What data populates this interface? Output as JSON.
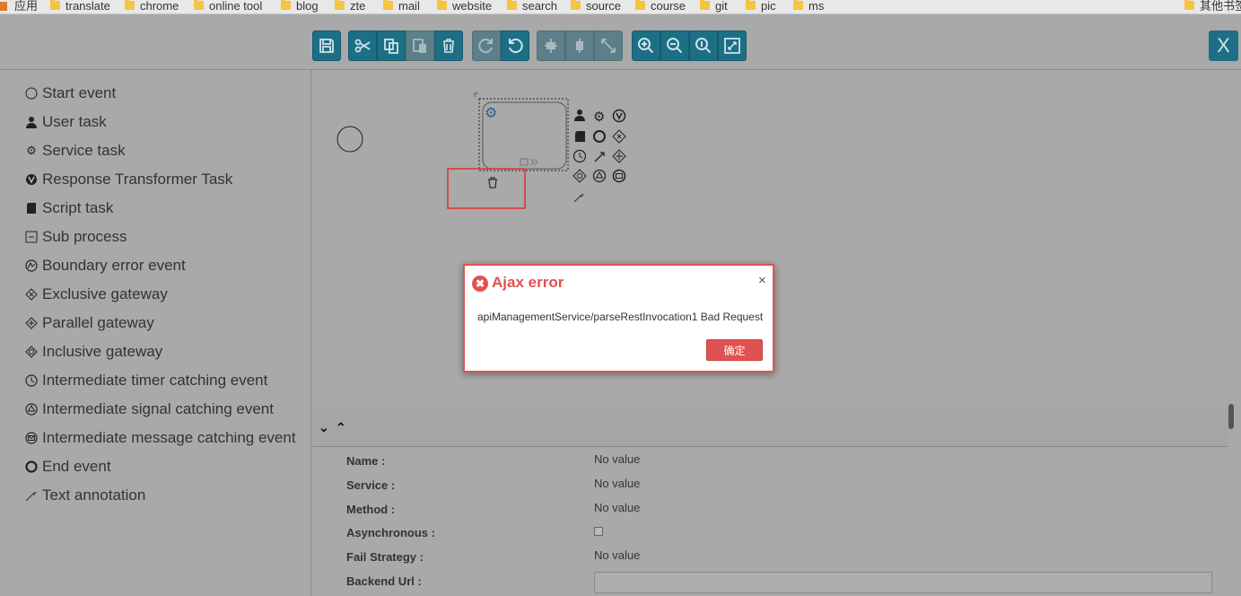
{
  "bookmarks": {
    "apps_label": "应用",
    "items": [
      "translate",
      "chrome",
      "online tool",
      "blog",
      "zte",
      "mail",
      "website",
      "search",
      "source",
      "course",
      "git",
      "pic",
      "ms"
    ],
    "other_label": "其他书签"
  },
  "toolbar": {
    "close_label": "X"
  },
  "palette": {
    "items": [
      {
        "label": "Start event",
        "icon": "start-event-icon"
      },
      {
        "label": "User task",
        "icon": "user-icon"
      },
      {
        "label": "Service task",
        "icon": "gear-icon"
      },
      {
        "label": "Response Transformer Task",
        "icon": "transformer-icon"
      },
      {
        "label": "Script task",
        "icon": "script-icon"
      },
      {
        "label": "Sub process",
        "icon": "subprocess-icon"
      },
      {
        "label": "Boundary error event",
        "icon": "error-event-icon"
      },
      {
        "label": "Exclusive gateway",
        "icon": "exclusive-gateway-icon"
      },
      {
        "label": "Parallel gateway",
        "icon": "parallel-gateway-icon"
      },
      {
        "label": "Inclusive gateway",
        "icon": "inclusive-gateway-icon"
      },
      {
        "label": "Intermediate timer catching event",
        "icon": "timer-icon"
      },
      {
        "label": "Intermediate signal catching event",
        "icon": "signal-icon"
      },
      {
        "label": "Intermediate message catching event",
        "icon": "message-icon"
      },
      {
        "label": "End event",
        "icon": "end-event-icon"
      },
      {
        "label": "Text annotation",
        "icon": "annotation-icon"
      }
    ]
  },
  "properties": {
    "name_label": "Name :",
    "name_value": "No value",
    "service_label": "Service :",
    "service_value": "No value",
    "method_label": "Method :",
    "method_value": "No value",
    "async_label": "Asynchronous :",
    "fail_label": "Fail Strategy :",
    "fail_value": "No value",
    "backend_label": "Backend Url :",
    "backend_value": ""
  },
  "dialog": {
    "title": "Ajax error",
    "message": "apiManagementService/parseRestInvocation1 Bad Request",
    "ok_label": "确定",
    "close_glyph": "×"
  },
  "colors": {
    "toolbar_button": "#1c6f85",
    "dialog_accent": "#e0524f"
  }
}
